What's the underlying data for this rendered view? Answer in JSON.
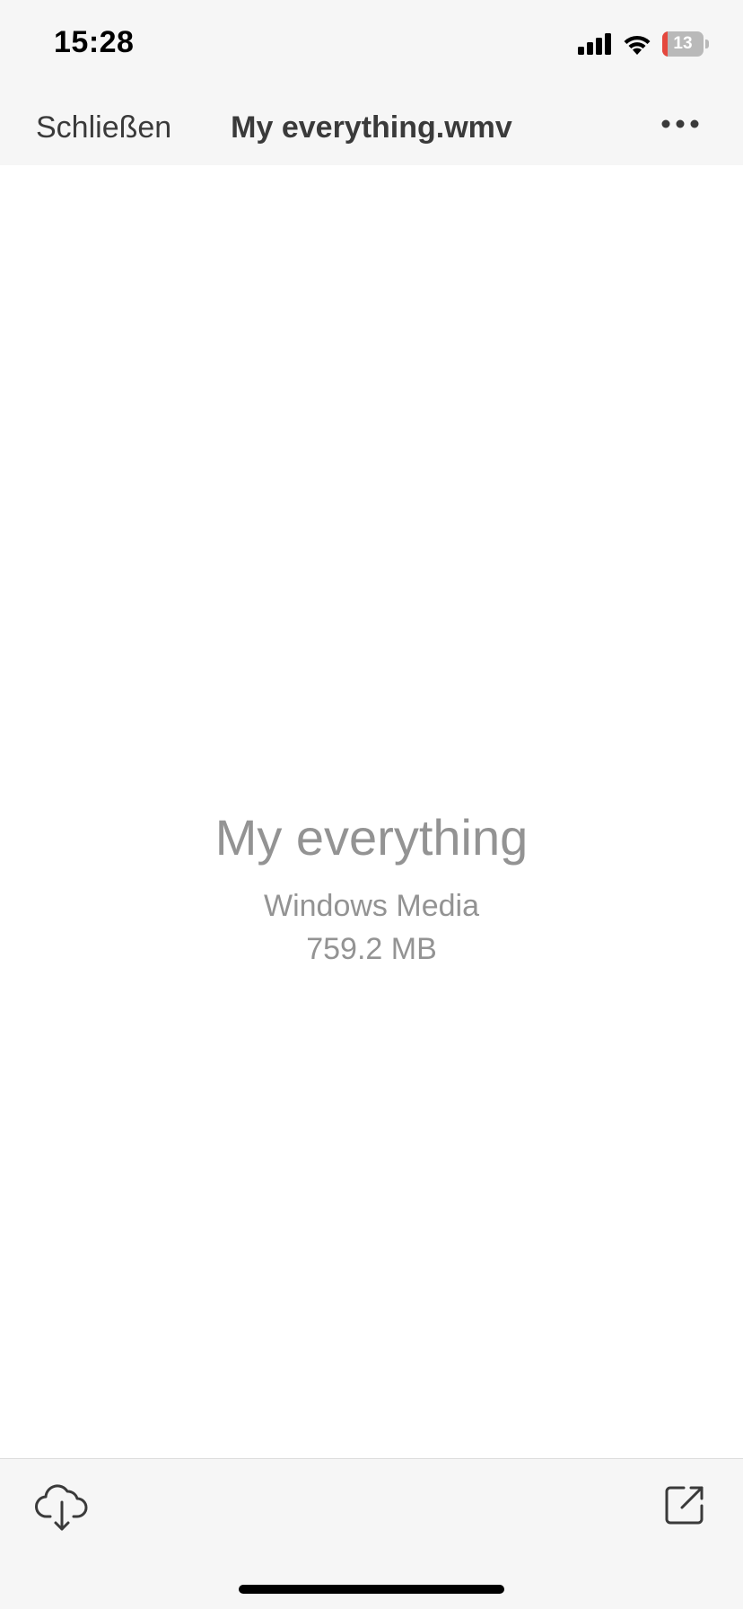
{
  "status_bar": {
    "time": "15:28",
    "battery_percent": "13",
    "battery_level": 0.13,
    "battery_color": "#e5483e",
    "icons": [
      "signal-icon",
      "wifi-icon",
      "battery-icon"
    ]
  },
  "nav": {
    "close_label": "Schließen",
    "title": "My everything.wmv",
    "more_icon": "ellipsis-icon"
  },
  "file": {
    "name": "My everything",
    "type": "Windows Media",
    "size": "759.2 MB"
  },
  "toolbar": {
    "download_icon": "cloud-download-icon",
    "share_icon": "open-external-icon"
  },
  "colors": {
    "bar_background": "#f6f6f6",
    "content_background": "#ffffff",
    "secondary_text": "#939393",
    "primary_text": "#3a3a3a"
  }
}
